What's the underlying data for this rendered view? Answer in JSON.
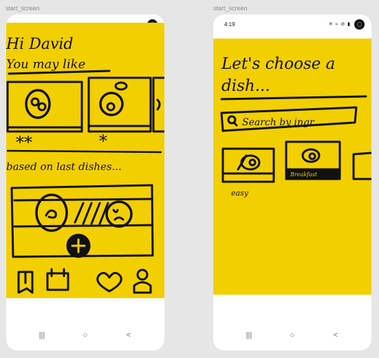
{
  "frames": [
    {
      "label": "start_screen",
      "status_time": "",
      "sketch": {
        "greeting": "Hi David",
        "section_1": "You may like",
        "rating_1": "**",
        "rating_2": "*",
        "section_2": "based on last dishes..."
      },
      "bottom_nav": [
        "recipes-icon",
        "calendar-icon",
        "heart-icon",
        "profile-icon"
      ]
    },
    {
      "label": "start_screen",
      "status_time": "4:19",
      "status_icons": "✕ ≈ ⊘ ▮",
      "sketch": {
        "title_line1": "Let's choose a",
        "title_line2": "dish...",
        "search_text": "Search by ingr.",
        "category_1": "easy",
        "category_2": "Breakfast"
      }
    }
  ],
  "system_nav": {
    "recents": "|||",
    "home": "○",
    "back": "<"
  },
  "colors": {
    "paper": "#f2cf00",
    "ink": "#111111",
    "background": "#e6e6e6"
  }
}
